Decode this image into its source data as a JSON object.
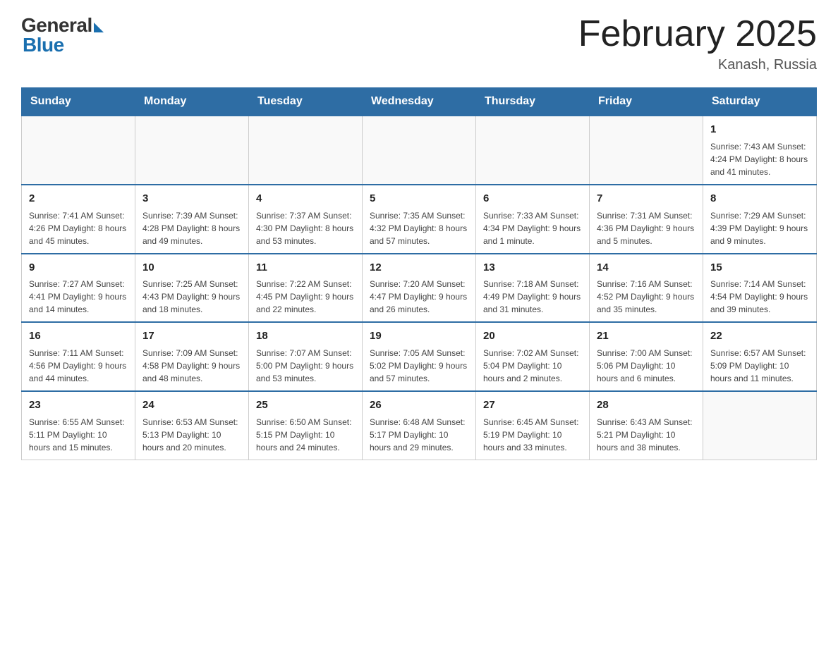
{
  "header": {
    "logo_general": "General",
    "logo_blue": "Blue",
    "month_title": "February 2025",
    "location": "Kanash, Russia"
  },
  "days_of_week": [
    "Sunday",
    "Monday",
    "Tuesday",
    "Wednesday",
    "Thursday",
    "Friday",
    "Saturday"
  ],
  "weeks": [
    [
      {
        "date": "",
        "info": ""
      },
      {
        "date": "",
        "info": ""
      },
      {
        "date": "",
        "info": ""
      },
      {
        "date": "",
        "info": ""
      },
      {
        "date": "",
        "info": ""
      },
      {
        "date": "",
        "info": ""
      },
      {
        "date": "1",
        "info": "Sunrise: 7:43 AM\nSunset: 4:24 PM\nDaylight: 8 hours\nand 41 minutes."
      }
    ],
    [
      {
        "date": "2",
        "info": "Sunrise: 7:41 AM\nSunset: 4:26 PM\nDaylight: 8 hours\nand 45 minutes."
      },
      {
        "date": "3",
        "info": "Sunrise: 7:39 AM\nSunset: 4:28 PM\nDaylight: 8 hours\nand 49 minutes."
      },
      {
        "date": "4",
        "info": "Sunrise: 7:37 AM\nSunset: 4:30 PM\nDaylight: 8 hours\nand 53 minutes."
      },
      {
        "date": "5",
        "info": "Sunrise: 7:35 AM\nSunset: 4:32 PM\nDaylight: 8 hours\nand 57 minutes."
      },
      {
        "date": "6",
        "info": "Sunrise: 7:33 AM\nSunset: 4:34 PM\nDaylight: 9 hours\nand 1 minute."
      },
      {
        "date": "7",
        "info": "Sunrise: 7:31 AM\nSunset: 4:36 PM\nDaylight: 9 hours\nand 5 minutes."
      },
      {
        "date": "8",
        "info": "Sunrise: 7:29 AM\nSunset: 4:39 PM\nDaylight: 9 hours\nand 9 minutes."
      }
    ],
    [
      {
        "date": "9",
        "info": "Sunrise: 7:27 AM\nSunset: 4:41 PM\nDaylight: 9 hours\nand 14 minutes."
      },
      {
        "date": "10",
        "info": "Sunrise: 7:25 AM\nSunset: 4:43 PM\nDaylight: 9 hours\nand 18 minutes."
      },
      {
        "date": "11",
        "info": "Sunrise: 7:22 AM\nSunset: 4:45 PM\nDaylight: 9 hours\nand 22 minutes."
      },
      {
        "date": "12",
        "info": "Sunrise: 7:20 AM\nSunset: 4:47 PM\nDaylight: 9 hours\nand 26 minutes."
      },
      {
        "date": "13",
        "info": "Sunrise: 7:18 AM\nSunset: 4:49 PM\nDaylight: 9 hours\nand 31 minutes."
      },
      {
        "date": "14",
        "info": "Sunrise: 7:16 AM\nSunset: 4:52 PM\nDaylight: 9 hours\nand 35 minutes."
      },
      {
        "date": "15",
        "info": "Sunrise: 7:14 AM\nSunset: 4:54 PM\nDaylight: 9 hours\nand 39 minutes."
      }
    ],
    [
      {
        "date": "16",
        "info": "Sunrise: 7:11 AM\nSunset: 4:56 PM\nDaylight: 9 hours\nand 44 minutes."
      },
      {
        "date": "17",
        "info": "Sunrise: 7:09 AM\nSunset: 4:58 PM\nDaylight: 9 hours\nand 48 minutes."
      },
      {
        "date": "18",
        "info": "Sunrise: 7:07 AM\nSunset: 5:00 PM\nDaylight: 9 hours\nand 53 minutes."
      },
      {
        "date": "19",
        "info": "Sunrise: 7:05 AM\nSunset: 5:02 PM\nDaylight: 9 hours\nand 57 minutes."
      },
      {
        "date": "20",
        "info": "Sunrise: 7:02 AM\nSunset: 5:04 PM\nDaylight: 10 hours\nand 2 minutes."
      },
      {
        "date": "21",
        "info": "Sunrise: 7:00 AM\nSunset: 5:06 PM\nDaylight: 10 hours\nand 6 minutes."
      },
      {
        "date": "22",
        "info": "Sunrise: 6:57 AM\nSunset: 5:09 PM\nDaylight: 10 hours\nand 11 minutes."
      }
    ],
    [
      {
        "date": "23",
        "info": "Sunrise: 6:55 AM\nSunset: 5:11 PM\nDaylight: 10 hours\nand 15 minutes."
      },
      {
        "date": "24",
        "info": "Sunrise: 6:53 AM\nSunset: 5:13 PM\nDaylight: 10 hours\nand 20 minutes."
      },
      {
        "date": "25",
        "info": "Sunrise: 6:50 AM\nSunset: 5:15 PM\nDaylight: 10 hours\nand 24 minutes."
      },
      {
        "date": "26",
        "info": "Sunrise: 6:48 AM\nSunset: 5:17 PM\nDaylight: 10 hours\nand 29 minutes."
      },
      {
        "date": "27",
        "info": "Sunrise: 6:45 AM\nSunset: 5:19 PM\nDaylight: 10 hours\nand 33 minutes."
      },
      {
        "date": "28",
        "info": "Sunrise: 6:43 AM\nSunset: 5:21 PM\nDaylight: 10 hours\nand 38 minutes."
      },
      {
        "date": "",
        "info": ""
      }
    ]
  ]
}
